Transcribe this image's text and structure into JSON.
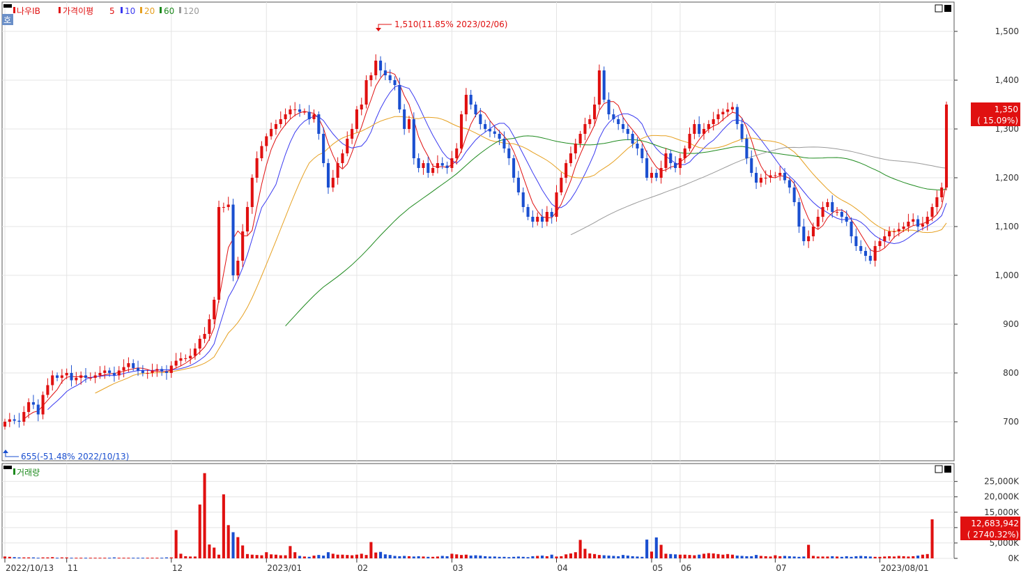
{
  "legend_price": {
    "stock": "나우IB",
    "indicator": "가격이평",
    "ma": [
      {
        "label": "5",
        "color": "#e01010"
      },
      {
        "label": "10",
        "color": "#3a3af0"
      },
      {
        "label": "20",
        "color": "#e6a020"
      },
      {
        "label": "60",
        "color": "#1e8a1e"
      },
      {
        "label": "120",
        "color": "#999999"
      }
    ],
    "hoga_icon": "호"
  },
  "legend_volume": {
    "label": "거래량"
  },
  "annotations": {
    "high": "1,510(11.85% 2023/02/06)",
    "low": "655(-51.48% 2022/10/13)"
  },
  "current_price": {
    "value": "1,350",
    "change": "( 15.09%)"
  },
  "current_volume": {
    "value": "12,683,942",
    "change": "( 2740.32%)"
  },
  "colors": {
    "up": "#e01010",
    "down": "#1a4fd0",
    "grid": "#e4e4e4",
    "axis": "#333333",
    "tag_bg": "#e01010"
  },
  "chart_data": {
    "type": "candlestick",
    "price_axis": {
      "ylim": [
        620,
        1560
      ],
      "ticks": [
        700,
        800,
        900,
        1000,
        1100,
        1200,
        1300,
        1400,
        1500
      ],
      "tick_labels": [
        "700",
        "800",
        "900",
        "1,000",
        "1,100",
        "1,200",
        "1,300",
        "1,400",
        "1,500"
      ]
    },
    "volume_axis": {
      "ylim": [
        0,
        29000
      ],
      "ticks": [
        0,
        5000,
        10000,
        15000,
        20000,
        25000
      ],
      "tick_labels": [
        "0K",
        "5,000K",
        "10,000K",
        "15,000K",
        "20,000K",
        "25,000K"
      ]
    },
    "x_labels": [
      {
        "label": "2022/10/13",
        "index": 0
      },
      {
        "label": "11",
        "index": 13
      },
      {
        "label": "12",
        "index": 35
      },
      {
        "label": "2023/01",
        "index": 55
      },
      {
        "label": "02",
        "index": 74
      },
      {
        "label": "03",
        "index": 94
      },
      {
        "label": "04",
        "index": 116
      },
      {
        "label": "05",
        "index": 136
      },
      {
        "label": "06",
        "index": 142
      },
      {
        "label": "07",
        "index": 162
      },
      {
        "label": "2023/08/01",
        "index": 184
      }
    ],
    "close": [
      700,
      705,
      702,
      700,
      720,
      740,
      735,
      715,
      755,
      775,
      795,
      790,
      795,
      800,
      785,
      790,
      795,
      790,
      790,
      795,
      800,
      805,
      800,
      795,
      805,
      812,
      820,
      810,
      805,
      800,
      800,
      805,
      808,
      803,
      800,
      815,
      825,
      830,
      830,
      835,
      850,
      870,
      880,
      910,
      950,
      1140,
      1140,
      1145,
      1000,
      1030,
      1090,
      1140,
      1200,
      1240,
      1265,
      1285,
      1300,
      1310,
      1320,
      1330,
      1340,
      1340,
      1335,
      1335,
      1320,
      1330,
      1290,
      1230,
      1180,
      1200,
      1230,
      1250,
      1280,
      1300,
      1340,
      1350,
      1400,
      1410,
      1440,
      1420,
      1410,
      1400,
      1390,
      1340,
      1300,
      1320,
      1240,
      1220,
      1230,
      1210,
      1220,
      1230,
      1225,
      1220,
      1240,
      1260,
      1330,
      1370,
      1350,
      1330,
      1310,
      1300,
      1295,
      1290,
      1280,
      1260,
      1240,
      1200,
      1170,
      1140,
      1120,
      1110,
      1120,
      1110,
      1130,
      1120,
      1170,
      1200,
      1230,
      1250,
      1270,
      1290,
      1310,
      1320,
      1350,
      1420,
      1360,
      1330,
      1320,
      1310,
      1300,
      1290,
      1270,
      1260,
      1240,
      1200,
      1210,
      1200,
      1220,
      1250,
      1230,
      1220,
      1240,
      1260,
      1290,
      1310,
      1290,
      1300,
      1310,
      1320,
      1330,
      1335,
      1340,
      1345,
      1310,
      1280,
      1240,
      1210,
      1190,
      1200,
      1200,
      1205,
      1205,
      1210,
      1195,
      1180,
      1150,
      1100,
      1070,
      1080,
      1100,
      1120,
      1140,
      1150,
      1130,
      1130,
      1120,
      1110,
      1080,
      1060,
      1050,
      1040,
      1030,
      1060,
      1070,
      1080,
      1090,
      1090,
      1095,
      1100,
      1110,
      1115,
      1100,
      1105,
      1120,
      1140,
      1160,
      1180,
      1350
    ],
    "volume": [
      600,
      500,
      400,
      300,
      300,
      300,
      300,
      200,
      300,
      300,
      400,
      200,
      300,
      300,
      200,
      200,
      200,
      200,
      200,
      200,
      200,
      200,
      200,
      300,
      200,
      200,
      200,
      200,
      200,
      200,
      200,
      200,
      200,
      200,
      300,
      300,
      9200,
      1500,
      700,
      600,
      600,
      17500,
      27700,
      4500,
      3500,
      1200,
      20800,
      10800,
      8500,
      6900,
      4200,
      1400,
      1200,
      1100,
      1000,
      2000,
      1300,
      1200,
      1000,
      1000,
      4000,
      2000,
      800,
      600,
      500,
      900,
      1100,
      900,
      2000,
      1500,
      1200,
      1200,
      1100,
      1000,
      1200,
      1500,
      1100,
      5300,
      1900,
      2100,
      1300,
      1100,
      800,
      700,
      800,
      700,
      600,
      700,
      600,
      500,
      500,
      600,
      800,
      700,
      1500,
      1300,
      1100,
      1200,
      900,
      1000,
      900,
      700,
      600,
      600,
      500,
      500,
      400,
      500,
      600,
      500,
      400,
      700,
      800,
      900,
      700,
      1200,
      600,
      700,
      1300,
      1600,
      2000,
      6000,
      3100,
      1600,
      1400,
      1100,
      1000,
      900,
      800,
      700,
      1100,
      900,
      700,
      600,
      500,
      6100,
      2200,
      6800,
      4400,
      1500,
      1400,
      1300,
      1200,
      1200,
      1100,
      1000,
      1200,
      1500,
      1700,
      1600,
      1400,
      1200,
      1400,
      1200,
      900,
      800,
      700,
      700,
      1100,
      800,
      700,
      600,
      1000,
      700,
      800,
      700,
      600,
      500,
      600,
      4400,
      800,
      600,
      600,
      600,
      700,
      600,
      500,
      700,
      500,
      700,
      800,
      700,
      600,
      500,
      500,
      600,
      700,
      600,
      800,
      700,
      600,
      700,
      900,
      1200,
      1400,
      12683
    ]
  }
}
